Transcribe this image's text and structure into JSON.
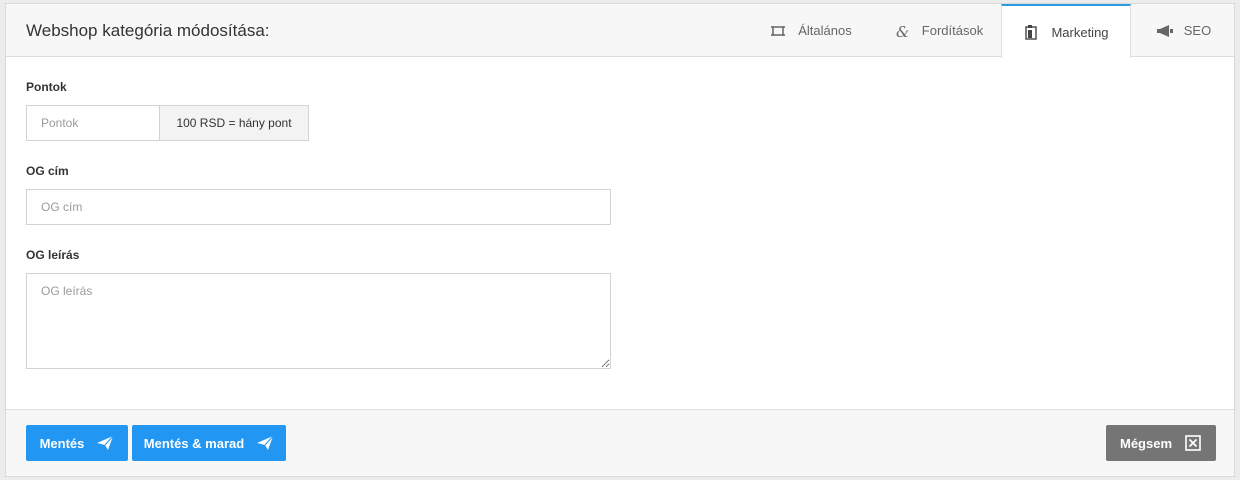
{
  "header": {
    "title": "Webshop kategória módosítása:",
    "tabs": [
      {
        "label": "Általános",
        "icon": "frame-icon"
      },
      {
        "label": "Fordítások",
        "icon": "ampersand-icon"
      },
      {
        "label": "Marketing",
        "icon": "clipboard-icon",
        "active": true
      },
      {
        "label": "SEO",
        "icon": "megaphone-icon"
      }
    ]
  },
  "form": {
    "points": {
      "label": "Pontok",
      "placeholder": "Pontok",
      "value": "",
      "addon": "100 RSD = hány pont"
    },
    "og_title": {
      "label": "OG cím",
      "placeholder": "OG cím",
      "value": ""
    },
    "og_description": {
      "label": "OG leírás",
      "placeholder": "OG leírás",
      "value": ""
    }
  },
  "footer": {
    "save_label": "Mentés",
    "save_stay_label": "Mentés & marad",
    "cancel_label": "Mégsem"
  },
  "colors": {
    "primary": "#2196f3",
    "cancel": "#757575",
    "active_tab_border": "#2c9be4"
  }
}
